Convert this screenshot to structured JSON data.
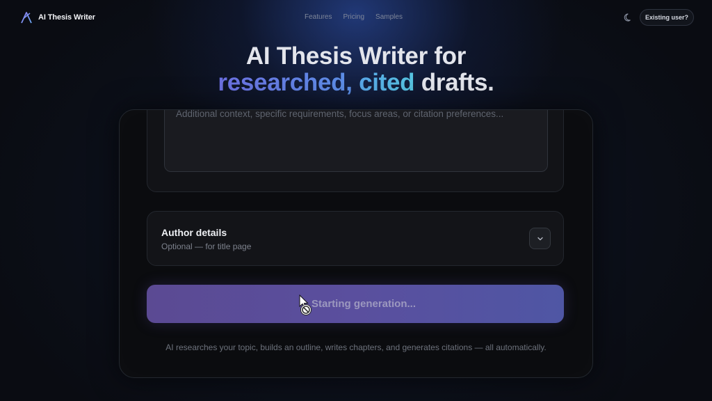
{
  "header": {
    "brand_name": "AI Thesis Writer",
    "logo_icon": "ai-letter-logo",
    "nav": [
      "Features",
      "Pricing",
      "Samples"
    ],
    "theme_icon": "moon-icon",
    "existing_user_label": "Existing user?"
  },
  "hero": {
    "line1": "AI Thesis Writer for",
    "line2_part1": "researched,",
    "line2_part2": "cited",
    "line2_part3": "drafts."
  },
  "form": {
    "context_placeholder": "Additional context, specific requirements, focus areas, or citation preferences...",
    "author_title": "Author details",
    "author_subtitle": "Optional — for title page",
    "author_toggle_icon": "chevron-down-icon",
    "generate_label": "Starting generation...",
    "helper_text": "AI researches your topic, builds an outline, writes chapters, and generates citations — all automatically."
  },
  "colors": {
    "gradient_start": "#6c6fe0",
    "gradient_end": "#56c4e0",
    "button_purple": "#5a4f9e",
    "background": "#0a0c12"
  }
}
